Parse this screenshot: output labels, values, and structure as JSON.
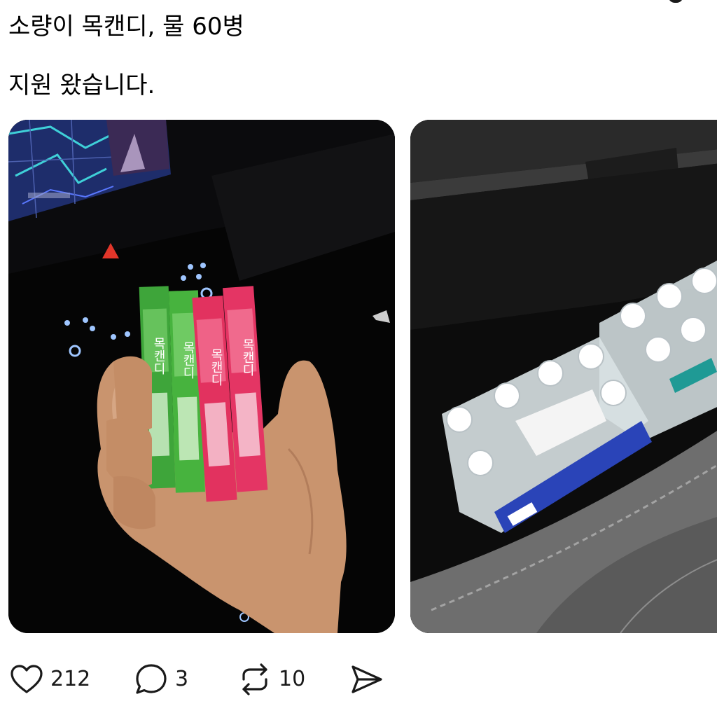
{
  "post": {
    "lines": [
      "소량이 목캔디, 물 60병",
      "지원 왔습니다."
    ]
  },
  "media": [
    {
      "name": "candy-photo",
      "candy_label": "목캔디"
    },
    {
      "name": "water-photo"
    }
  ],
  "actions": {
    "like_count": "212",
    "reply_count": "3",
    "repost_count": "10"
  },
  "icons": [
    "heart-icon",
    "reply-icon",
    "repost-icon",
    "share-icon"
  ]
}
